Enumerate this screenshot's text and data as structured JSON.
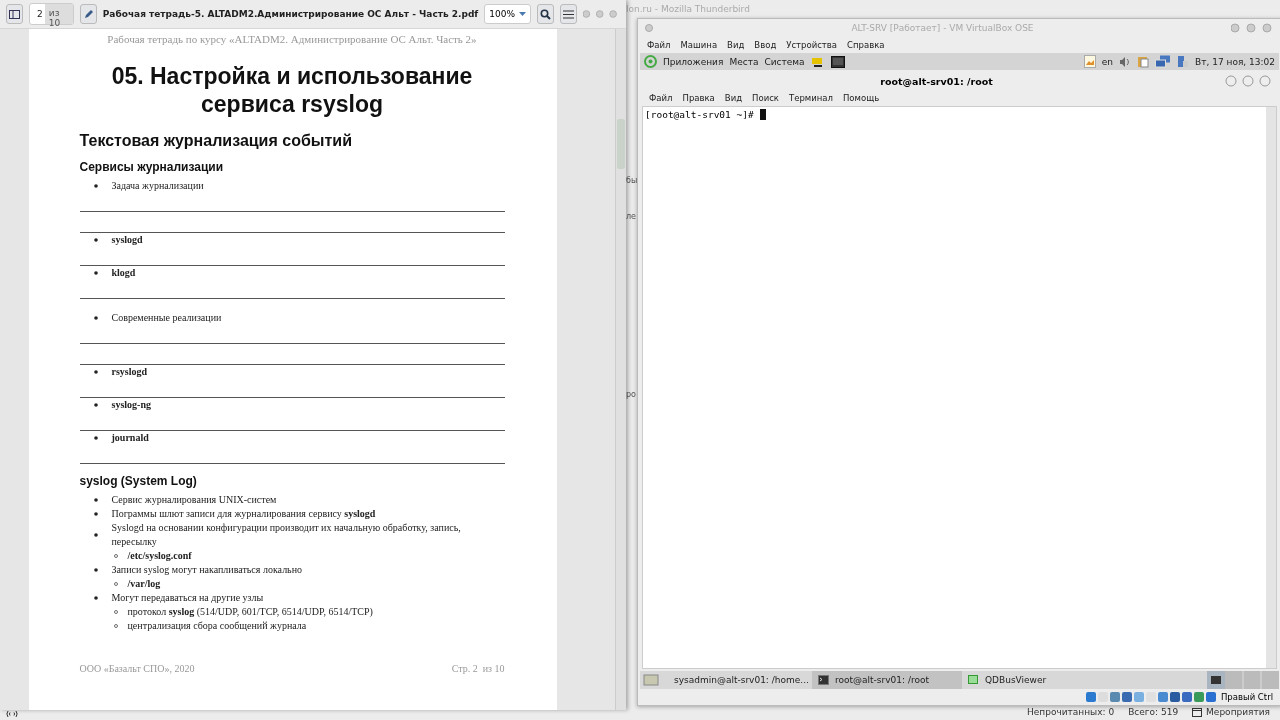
{
  "pdf_viewer": {
    "page_number": "2",
    "page_count": "из 10",
    "file_title": "Рабочая тетрадь-5. ALTADM2.Администрирование ОС Альт - Часть 2.pdf",
    "zoom": "100%",
    "page": {
      "running_header": "Рабочая тетрадь по курсу «ALTADM2. Администрирование ОС Альт. Часть 2»",
      "title": "05. Настройка и использование сервиса rsyslog",
      "section": "Текстовая журнализация событий",
      "blocks": [
        {
          "kind": "heading",
          "text": "Сервисы журнализации"
        },
        {
          "kind": "bullet",
          "text": "Задача журнализации",
          "bold": false
        },
        {
          "kind": "line"
        },
        {
          "kind": "line"
        },
        {
          "kind": "bullet",
          "text": "syslogd",
          "bold": true
        },
        {
          "kind": "line"
        },
        {
          "kind": "bullet",
          "text": "klogd",
          "bold": true
        },
        {
          "kind": "line"
        },
        {
          "kind": "gap"
        },
        {
          "kind": "bullet",
          "text": "Современные реализации",
          "bold": false
        },
        {
          "kind": "line"
        },
        {
          "kind": "line"
        },
        {
          "kind": "bullet",
          "text": "rsyslogd",
          "bold": true
        },
        {
          "kind": "line"
        },
        {
          "kind": "bullet",
          "text": "syslog-ng",
          "bold": true
        },
        {
          "kind": "line"
        },
        {
          "kind": "bullet",
          "text": "journald",
          "bold": true
        },
        {
          "kind": "line"
        },
        {
          "kind": "heading",
          "text": "syslog (System Log)"
        },
        {
          "kind": "bullet",
          "text": "Сервис журналирования UNIX-систем",
          "bold": false
        },
        {
          "kind": "bullet",
          "text": "Пограммы шлют записи для журналирования сервису **syslogd**",
          "bold": false
        },
        {
          "kind": "bullet",
          "text": "Syslogd на основании конфигурации производит их начальную обработку, запись, пересылку",
          "bold": false
        },
        {
          "kind": "sub",
          "text": "/etc/syslog.conf",
          "bold": true
        },
        {
          "kind": "bullet",
          "text": "Записи syslog могут накапливаться локально",
          "bold": false
        },
        {
          "kind": "sub",
          "text": "/var/log",
          "bold": true
        },
        {
          "kind": "bullet",
          "text": "Могут передаваться на другие узлы",
          "bold": false
        },
        {
          "kind": "sub",
          "text": "протокол **syslog** (514/UDP, 601/TCP, 6514/UDP, 6514/TCP)",
          "bold": false
        },
        {
          "kind": "sub",
          "text": "централизация сбора сообщений журнала",
          "bold": false
        }
      ],
      "footer_left": "ООО «Базальт СПО», 2020",
      "footer_page": "Стр. 2",
      "footer_count": "из 10"
    }
  },
  "thunderbird": {
    "window_title": "lon.ru - Mozilla Thunderbird",
    "cut_fragments": [
      "бы",
      "ле",
      "ро"
    ],
    "status_bar": {
      "unread": "Непрочитанных: 0",
      "total": "Всего: 519",
      "events": "Мероприятия"
    }
  },
  "virtualbox": {
    "window_title": "ALT-SRV [Работает] - VM VirtualBox OSE",
    "menu": [
      "Файл",
      "Машина",
      "Вид",
      "Ввод",
      "Устройства",
      "Справка"
    ],
    "guest_panel": {
      "menus": [
        "Приложения",
        "Места",
        "Система"
      ],
      "keyboard_layout": "en",
      "clock": "Вт, 17 ноя, 13:02"
    },
    "terminal": {
      "title": "root@alt-srv01: /root",
      "menu": [
        "Файл",
        "Правка",
        "Вид",
        "Поиск",
        "Терминал",
        "Помощь"
      ],
      "prompt": "[root@alt-srv01 ~]#"
    },
    "taskbar": [
      {
        "kind": "terminal",
        "label": "sysadmin@alt-srv01: /home...",
        "selected": false
      },
      {
        "kind": "terminal",
        "label": "root@alt-srv01: /root",
        "selected": true
      },
      {
        "kind": "app",
        "label": "QDBusViewer",
        "selected": false
      }
    ],
    "host_key": "Правый Ctrl"
  }
}
